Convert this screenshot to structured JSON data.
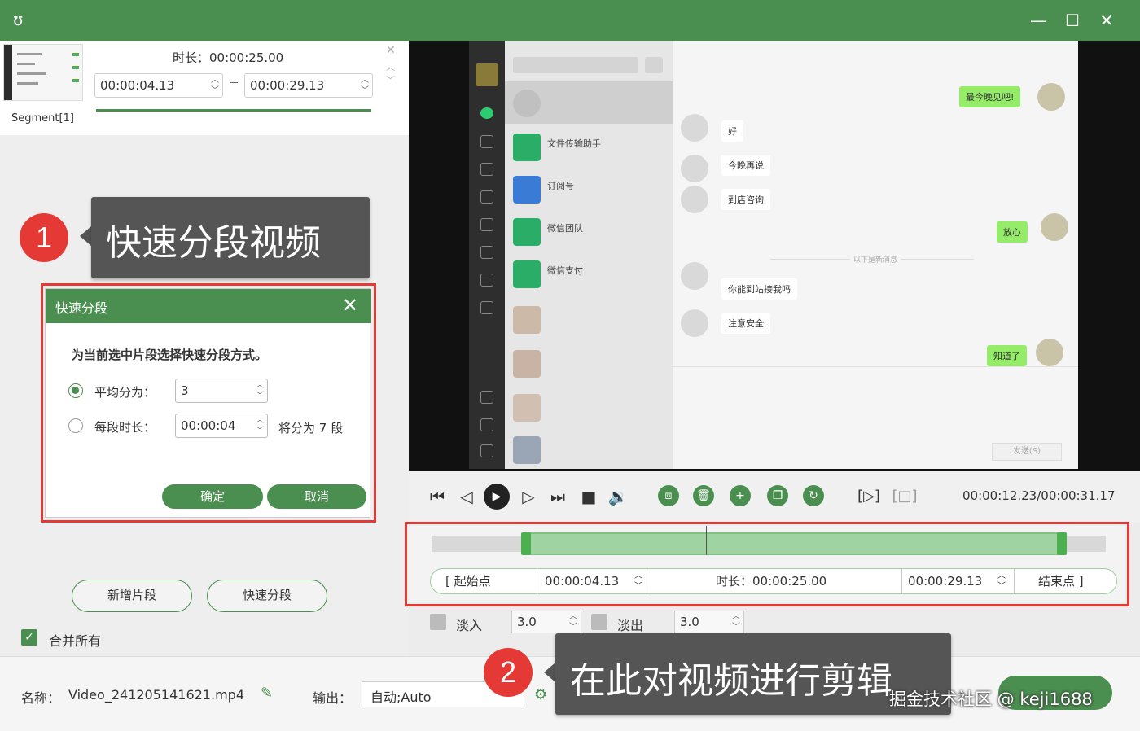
{
  "window": {
    "minimize": "—",
    "maximize": "☐",
    "close": "✕"
  },
  "segment": {
    "thumb_label": "Segment[1]",
    "duration": "时长：00:00:25.00",
    "start": "00:00:04.13",
    "end": "00:00:29.13"
  },
  "callout1": {
    "badge": "1",
    "text": "快速分段视频"
  },
  "callout2": {
    "badge": "2",
    "text": "在此对视频进行剪辑"
  },
  "dialog": {
    "title": "快速分段",
    "prompt": "为当前选中片段选择快速分段方式。",
    "option_even_label": "平均分为：",
    "option_even_value": "3",
    "option_each_label": "每段时长：",
    "option_each_value": "00:00:04",
    "option_each_result": "将分为 7 段",
    "ok": "确定",
    "cancel": "取消"
  },
  "left_actions": {
    "add_segment": "新增片段",
    "quick_split": "快速分段",
    "merge_all": "合并所有"
  },
  "bottom": {
    "name_label": "名称：",
    "name_value": "Video_241205141621.mp4",
    "output_label": "输出：",
    "output_value": "自动;Auto"
  },
  "player": {
    "time": "00:00:12.23/00:00:31.17"
  },
  "timeline": {
    "start_label": "[  起始点",
    "start_time": "00:00:04.13",
    "duration": "时长：00:00:25.00",
    "end_time": "00:00:29.13",
    "end_label": "结束点  ]"
  },
  "fade": {
    "fade_in_label": "淡入",
    "fade_in_value": "3.0",
    "fade_out_label": "淡出",
    "fade_out_value": "3.0"
  },
  "preview_chat": {
    "list": [
      "文件传输助手",
      "订阅号",
      "微信团队",
      "微信支付"
    ],
    "messages": [
      {
        "side": "me",
        "text": "最今晚见吧!"
      },
      {
        "side": "them",
        "text": "好"
      },
      {
        "side": "them",
        "text": "今晚再说"
      },
      {
        "side": "them",
        "text": "到店咨询"
      },
      {
        "side": "me",
        "text": "放心"
      },
      {
        "side": "them",
        "text": "你能到站接我吗"
      },
      {
        "side": "them",
        "text": "注意安全"
      },
      {
        "side": "me",
        "text": "知道了"
      }
    ],
    "send": "发送(S)",
    "divider": "以下是新消息"
  },
  "watermark": "掘金技术社区 @ keji1688",
  "colors": {
    "brand_green": "#4a8f4f",
    "highlight_red": "#e53935"
  }
}
